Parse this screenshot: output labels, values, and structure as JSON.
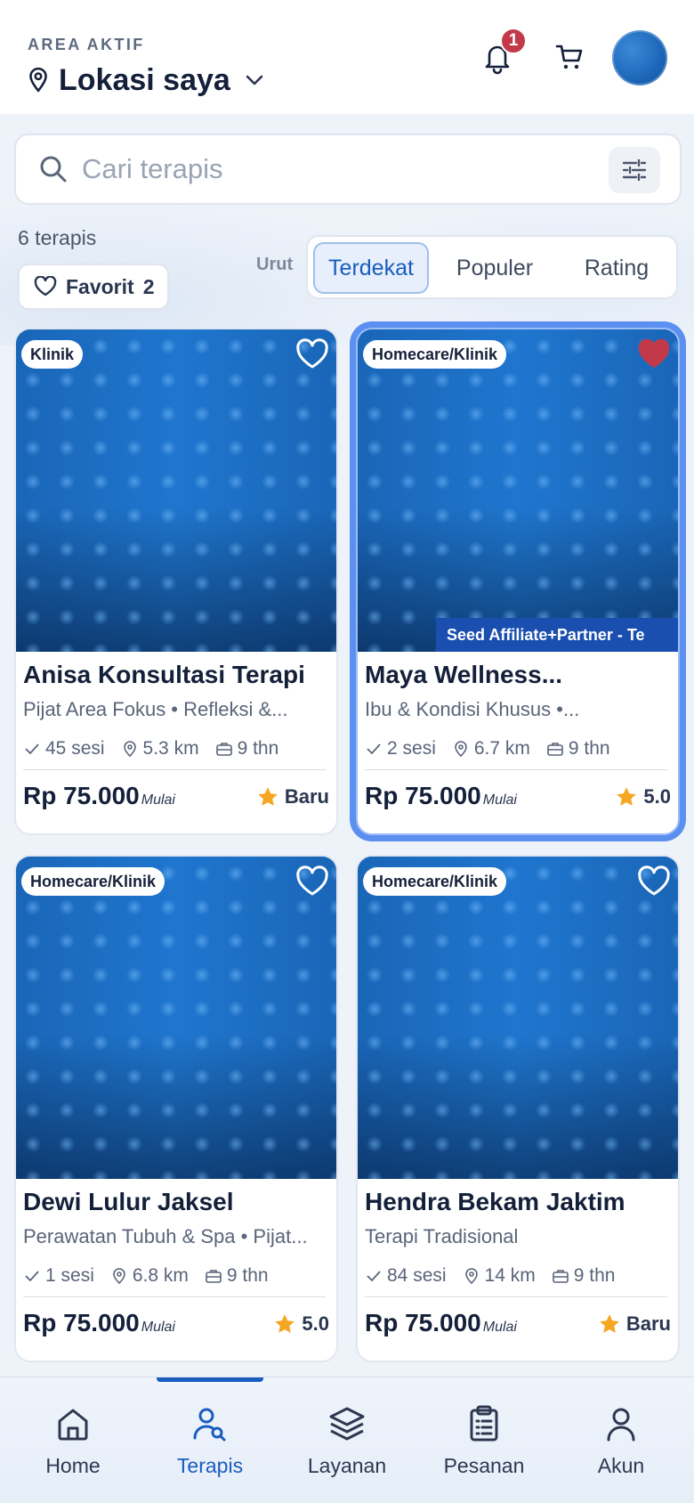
{
  "header": {
    "area_label": "AREA AKTIF",
    "location": "Lokasi saya",
    "notification_count": "1"
  },
  "search": {
    "placeholder": "Cari terapis"
  },
  "results": {
    "count_text": "6 terapis"
  },
  "favorites": {
    "label": "Favorit",
    "count": "2"
  },
  "sort": {
    "label": "Urut",
    "options": [
      "Terdekat",
      "Populer",
      "Rating"
    ],
    "selected": "Terdekat"
  },
  "therapists": [
    {
      "tag": "Klinik",
      "name": "Anisa Konsultasi Terapi",
      "category": "Pijat Area Fokus • Refleksi &...",
      "sessions": "45 sesi",
      "distance": "5.3 km",
      "experience": "9 thn",
      "price": "Rp 75.000",
      "price_note": "Mulai",
      "rating": "Baru",
      "favorite": false,
      "ribbon": ""
    },
    {
      "tag": "Homecare/Klinik",
      "name": "Maya Wellness...",
      "category": "Ibu & Kondisi Khusus •...",
      "sessions": "2 sesi",
      "distance": "6.7 km",
      "experience": "9 thn",
      "price": "Rp 75.000",
      "price_note": "Mulai",
      "rating": "5.0",
      "favorite": true,
      "ribbon": "Seed Affiliate+Partner - Te"
    },
    {
      "tag": "Homecare/Klinik",
      "name": "Dewi Lulur Jaksel",
      "category": "Perawatan Tubuh & Spa • Pijat...",
      "sessions": "1 sesi",
      "distance": "6.8 km",
      "experience": "9 thn",
      "price": "Rp 75.000",
      "price_note": "Mulai",
      "rating": "5.0",
      "favorite": false,
      "ribbon": ""
    },
    {
      "tag": "Homecare/Klinik",
      "name": "Hendra Bekam Jaktim",
      "category": "Terapi Tradisional",
      "sessions": "84 sesi",
      "distance": "14 km",
      "experience": "9 thn",
      "price": "Rp 75.000",
      "price_note": "Mulai",
      "rating": "Baru",
      "favorite": false,
      "ribbon": ""
    }
  ],
  "nav": {
    "items": [
      {
        "label": "Home",
        "icon": "home-icon"
      },
      {
        "label": "Terapis",
        "icon": "therapist-search-icon"
      },
      {
        "label": "Layanan",
        "icon": "layers-icon"
      },
      {
        "label": "Pesanan",
        "icon": "clipboard-icon"
      },
      {
        "label": "Akun",
        "icon": "user-icon"
      }
    ],
    "active": "Terapis"
  },
  "colors": {
    "accent": "#1a5cbf",
    "badge": "#c23a4a",
    "favorite": "#c23a4a",
    "star": "#f5a623",
    "selected_outline": "#5b8ff0"
  }
}
